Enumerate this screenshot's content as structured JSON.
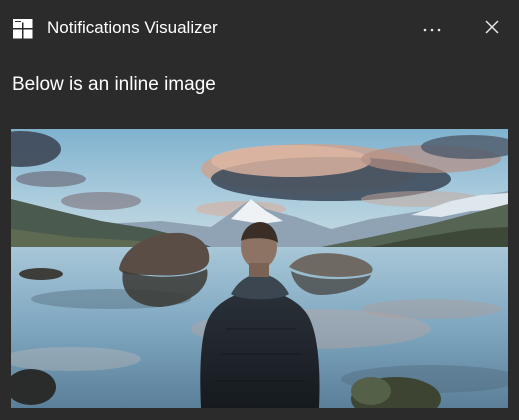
{
  "toast": {
    "app_name": "Notifications Visualizer",
    "body_text": "Below is an inline image",
    "app_icon": "windows-tiles-icon",
    "more_icon": "more-ellipsis-icon",
    "close_icon": "close-icon",
    "inline_image": {
      "subject": "person-overlooking-mountain-lake-photo"
    }
  },
  "colors": {
    "background": "#2b2b2b",
    "text": "#ffffff"
  }
}
